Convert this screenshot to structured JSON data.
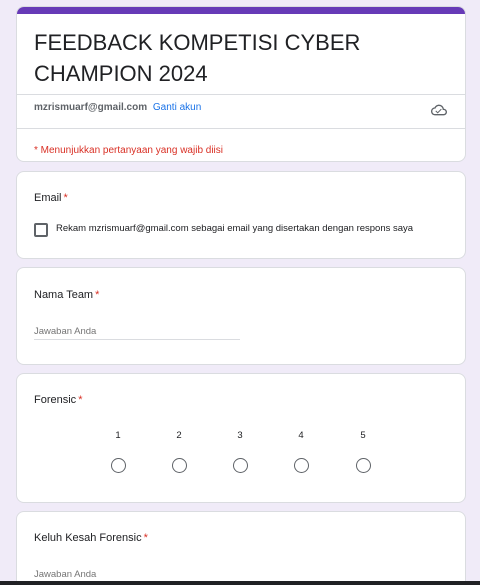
{
  "header": {
    "title": "FEEDBACK KOMPETISI CYBER CHAMPION 2024",
    "account_email": "mzrismuarf@gmail.com",
    "switch_account": "Ganti akun",
    "required_note": "* Menunjukkan pertanyaan yang wajib diisi",
    "accent_color": "#673ab7"
  },
  "questions": {
    "email": {
      "title": "Email",
      "required_mark": "*",
      "checkbox_label": "Rekam mzrismuarf@gmail.com sebagai email yang disertakan dengan respons saya",
      "checked": false
    },
    "team": {
      "title": "Nama Team",
      "required_mark": "*",
      "placeholder": "Jawaban Anda"
    },
    "forensic": {
      "title": "Forensic",
      "required_mark": "*",
      "scale": [
        "1",
        "2",
        "3",
        "4",
        "5"
      ]
    },
    "forensic_complaint": {
      "title": "Keluh Kesah Forensic",
      "required_mark": "*",
      "placeholder": "Jawaban Anda"
    }
  },
  "icons": {
    "cloud": "cloud-saved-icon"
  }
}
